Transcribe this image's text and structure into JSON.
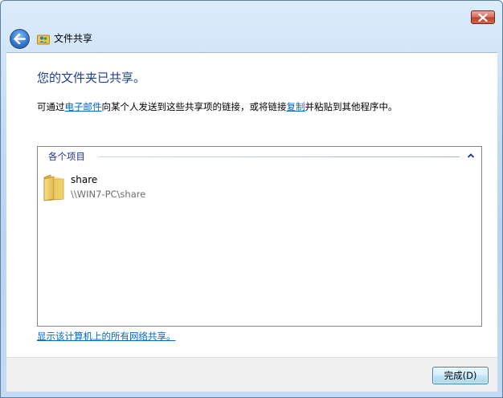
{
  "window": {
    "title": "文件共享",
    "close_icon": "close-icon",
    "back_icon": "back-arrow-icon"
  },
  "content": {
    "heading": "您的文件夹已共享。",
    "description": {
      "part1": "可通过",
      "link_email": "电子邮件",
      "part2": "向某个人发送到这些共享项的链接，或将链接",
      "link_copy": "复制",
      "part3": "并粘贴到其他程序中。"
    },
    "group": {
      "header": "各个项目",
      "collapse_icon": "chevron-up-icon"
    },
    "items": [
      {
        "name": "share",
        "path": "\\\\WIN7-PC\\share",
        "icon": "folder-icon"
      }
    ],
    "show_all_link": "显示该计算机上的所有网络共享。"
  },
  "footer": {
    "finish_label": "完成(D)"
  },
  "colors": {
    "heading": "#1e3e8f",
    "link": "#0066cc",
    "group_header": "#1e3287"
  }
}
